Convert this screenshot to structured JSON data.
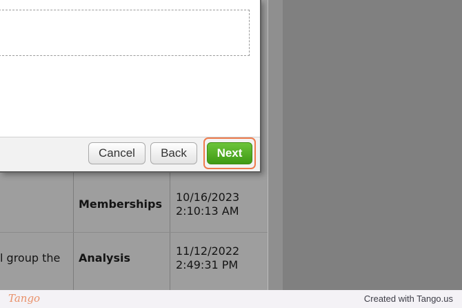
{
  "dialog": {
    "buttons": {
      "cancel": "Cancel",
      "back": "Back",
      "next": "Next"
    }
  },
  "table": {
    "rows": [
      {
        "description": "",
        "type": "Memberships",
        "date": "10/16/2023",
        "time": "2:10:13 AM"
      },
      {
        "description": "l group the",
        "type": "Analysis",
        "date": "11/12/2022",
        "time": "2:49:31 PM"
      }
    ]
  },
  "footer": {
    "logo": "Tango",
    "credit": "Created with Tango.us"
  },
  "colors": {
    "next_button": "#4da61f",
    "highlight": "#ee7a4b",
    "overlay": "#808080"
  }
}
